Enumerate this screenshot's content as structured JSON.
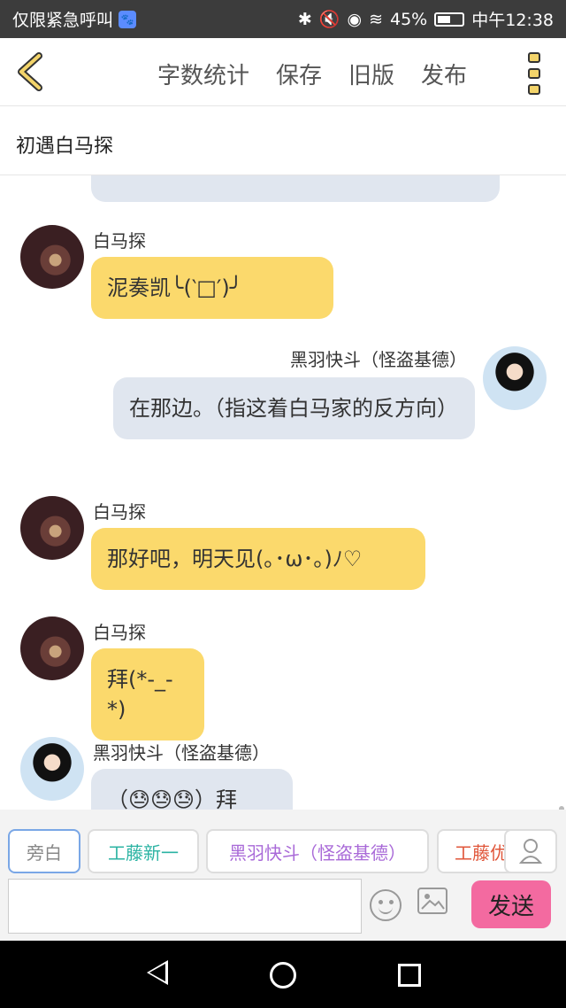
{
  "status_bar": {
    "left_text": "仅限紧急呼叫",
    "battery": "45%",
    "time": "中午12:38"
  },
  "toolbar": {
    "actions": [
      "字数统计",
      "保存",
      "旧版",
      "发布"
    ]
  },
  "story": {
    "title": "初遇白马探"
  },
  "messages": [
    {
      "name": "白马探",
      "text": "泥奏凯╰(‵□′)╯",
      "side": "left"
    },
    {
      "name": "黑羽快斗（怪盗基德）",
      "text": "在那边。（指这着白马家的反方向）",
      "side": "right"
    },
    {
      "name": "白马探",
      "text": "那好吧，明天见(｡･ω･｡)ﾉ♡",
      "side": "left"
    },
    {
      "name": "白马探",
      "text": "拜(*-_-*)",
      "side": "left"
    },
    {
      "name": "黑羽快斗（怪盗基德）",
      "text": "（😓😓😓）拜",
      "side": "left"
    }
  ],
  "roles": [
    {
      "label": "旁白",
      "color": "#888888"
    },
    {
      "label": "工藤新一",
      "color": "#2bb3a3"
    },
    {
      "label": "黑羽快斗（怪盗基德）",
      "color": "#a96ad8"
    },
    {
      "label": "工藤优",
      "color": "#e0563a"
    }
  ],
  "input": {
    "placeholder": ""
  },
  "send_label": "发送"
}
